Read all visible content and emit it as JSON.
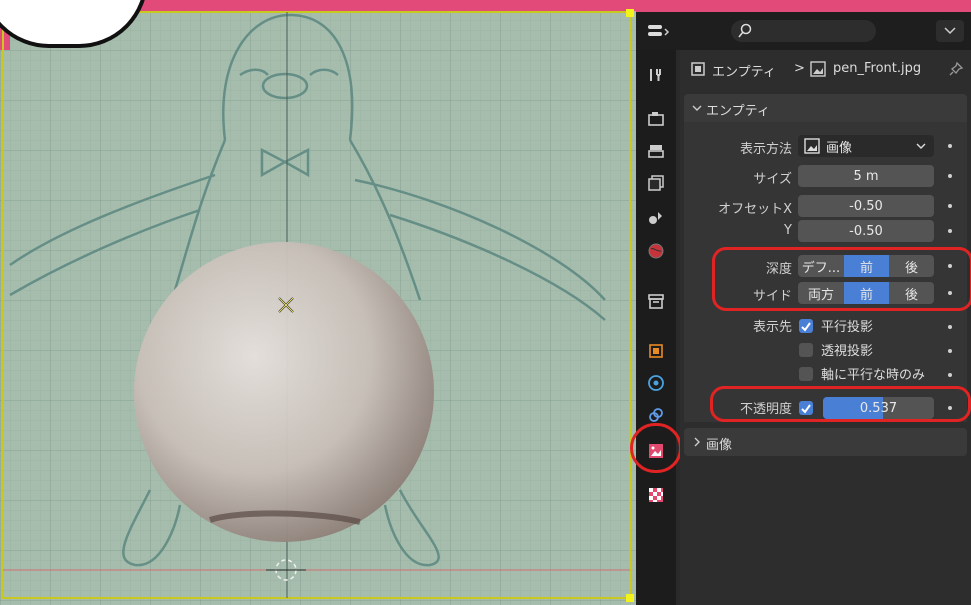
{
  "breadcrumb": {
    "object": "エンプティ",
    "separator": ">",
    "image": "pen_Front.jpg"
  },
  "search": {
    "placeholder": ""
  },
  "empty_panel": {
    "title": "エンプティ",
    "display_label": "表示方法",
    "display_value": "画像",
    "size_label": "サイズ",
    "size_value": "5 m",
    "offset_x_label": "オフセットX",
    "offset_x_value": "-0.50",
    "offset_y_label": "Y",
    "offset_y_value": "-0.50",
    "depth_label": "深度",
    "depth_options": [
      "デフ...",
      "前",
      "後"
    ],
    "depth_selected": "前",
    "side_label": "サイド",
    "side_options": [
      "両方",
      "前",
      "後"
    ],
    "side_selected": "前",
    "show_in_label": "表示先",
    "orthographic": {
      "label": "平行投影",
      "checked": true
    },
    "perspective": {
      "label": "透視投影",
      "checked": false
    },
    "axis_aligned": {
      "label": "軸に平行な時のみ",
      "checked": false
    },
    "opacity_label": "不透明度",
    "opacity_checked": true,
    "opacity_value": "0.537",
    "opacity_fraction": 0.537
  },
  "image_panel": {
    "title": "画像"
  },
  "colors": {
    "accent": "#4a7fd6",
    "highlight": "#e02424",
    "pink": "#e24a7a"
  }
}
